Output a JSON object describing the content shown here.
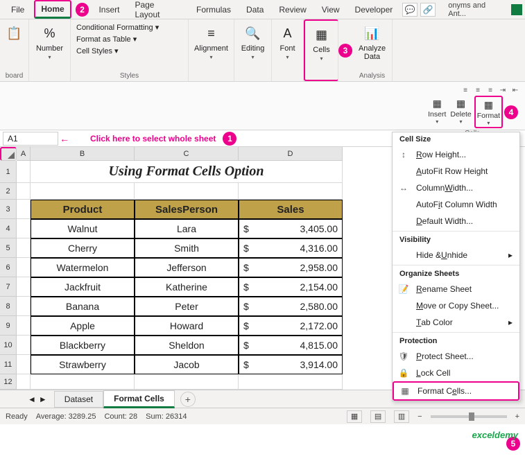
{
  "ribbon_tabs": {
    "file": "File",
    "home": "Home",
    "insert": "Insert",
    "pagelayout": "Page Layout",
    "formulas": "Formulas",
    "data": "Data",
    "review": "Review",
    "view": "View",
    "developer": "Developer"
  },
  "ribbon": {
    "clipboard": "board",
    "number": "Number",
    "styles_items": [
      "Conditional Formatting ▾",
      "Format as Table ▾",
      "Cell Styles ▾"
    ],
    "styles_label": "Styles",
    "alignment": "Alignment",
    "editing": "Editing",
    "font": "Font",
    "cells": "Cells",
    "analyze": "Analyze Data",
    "analysis": "Analysis",
    "right_text": "onyms and Ant..."
  },
  "cells_group": {
    "insert": "Insert",
    "delete": "Delete",
    "format": "Format",
    "label": "Cells"
  },
  "markers": {
    "m1": "1",
    "m2": "2",
    "m3": "3",
    "m4": "4",
    "m5": "5"
  },
  "namebox": "A1",
  "hint": "Click here to select whole sheet",
  "title": "Using Format Cells Option",
  "columns": [
    "A",
    "B",
    "C",
    "D"
  ],
  "rows": [
    "1",
    "2",
    "3",
    "4",
    "5",
    "6",
    "7",
    "8",
    "9",
    "10",
    "11",
    "12"
  ],
  "headers": {
    "product": "Product",
    "sp": "SalesPerson",
    "sales": "Sales"
  },
  "chart_data": {
    "type": "table",
    "columns": [
      "Product",
      "SalesPerson",
      "Sales"
    ],
    "rows": [
      {
        "product": "Walnut",
        "sp": "Lara",
        "sales": "3,405.00"
      },
      {
        "product": "Cherry",
        "sp": "Smith",
        "sales": "4,316.00"
      },
      {
        "product": "Watermelon",
        "sp": "Jefferson",
        "sales": "2,958.00"
      },
      {
        "product": "Jackfruit",
        "sp": "Katherine",
        "sales": "2,154.00"
      },
      {
        "product": "Banana",
        "sp": "Peter",
        "sales": "2,580.00"
      },
      {
        "product": "Apple",
        "sp": "Howard",
        "sales": "2,172.00"
      },
      {
        "product": "Blackberry",
        "sp": "Sheldon",
        "sales": "4,815.00"
      },
      {
        "product": "Strawberry",
        "sp": "Jacob",
        "sales": "3,914.00"
      }
    ]
  },
  "sheets": {
    "dataset": "Dataset",
    "formatcells": "Format Cells"
  },
  "status": {
    "ready": "Ready",
    "avg": "Average: 3289.25",
    "count": "Count: 28",
    "sum": "Sum: 26314"
  },
  "dropdown": {
    "cellsize": "Cell Size",
    "rowheight": "Row Height...",
    "autofitrow": "AutoFit Row Height",
    "colwidth": "Column Width...",
    "autofitcol": "AutoFit Column Width",
    "defwidth": "Default Width...",
    "visibility": "Visibility",
    "hide": "Hide & Unhide",
    "organize": "Organize Sheets",
    "rename": "Rename Sheet",
    "move": "Move or Copy Sheet...",
    "tabcolor": "Tab Color",
    "protection": "Protection",
    "protect": "Protect Sheet...",
    "lock": "Lock Cell",
    "formatcells": "Format Cells..."
  },
  "watermark": "exceldemy"
}
